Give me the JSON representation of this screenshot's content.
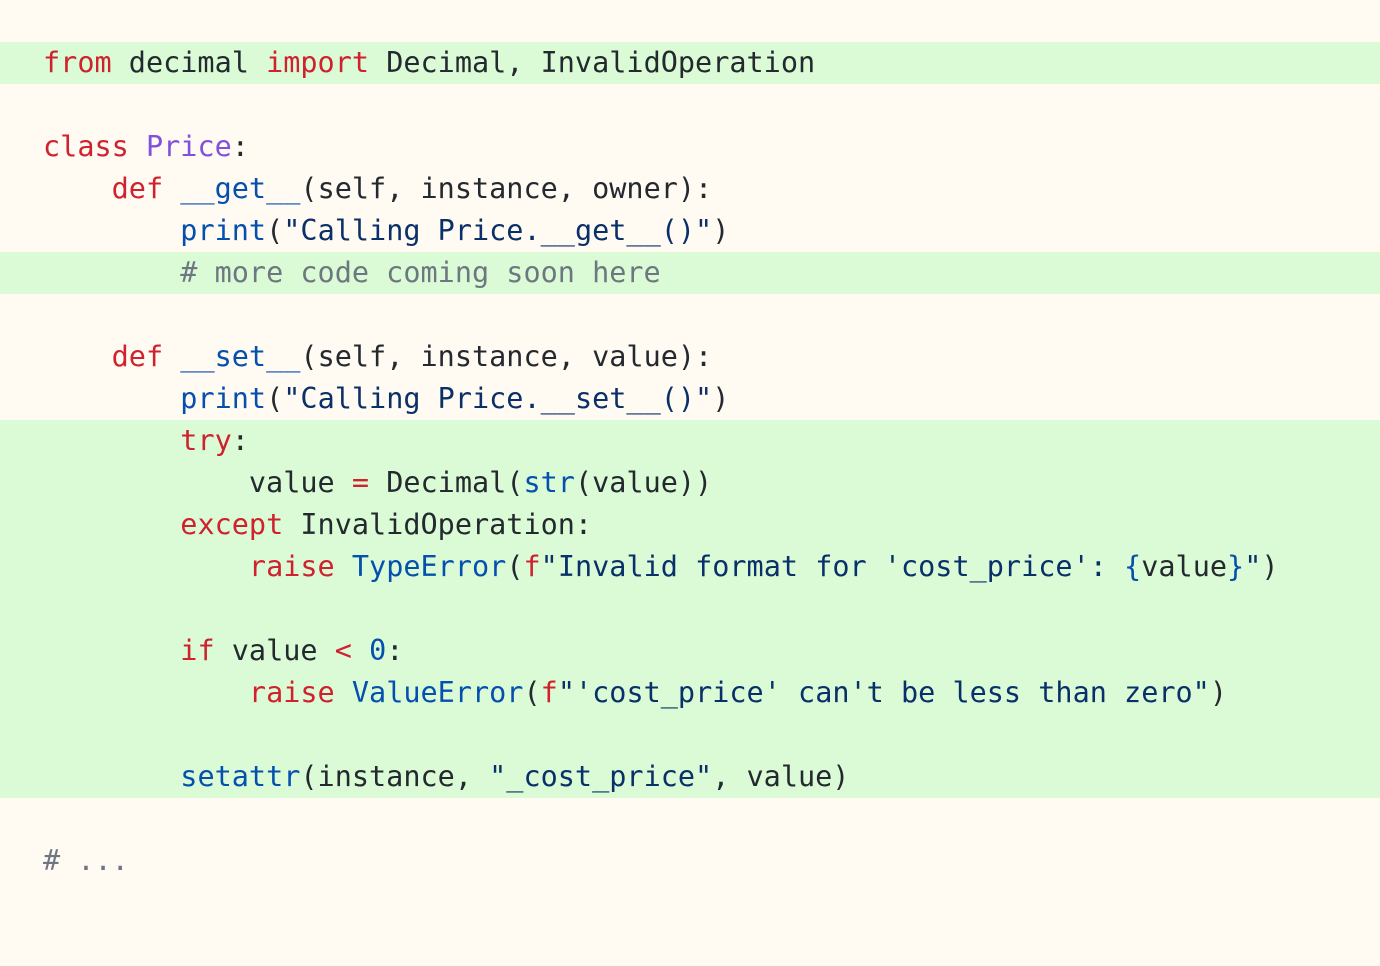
{
  "editor": {
    "background": "#fffaf2",
    "highlight_color": "#dafbd6",
    "lines": [
      {
        "hl": true,
        "tokens": [
          {
            "t": "from",
            "c": "keyword"
          },
          {
            "t": " decimal ",
            "c": "plain"
          },
          {
            "t": "import",
            "c": "keyword"
          },
          {
            "t": " Decimal, InvalidOperation",
            "c": "plain"
          }
        ]
      },
      {
        "hl": false,
        "tokens": []
      },
      {
        "hl": false,
        "tokens": [
          {
            "t": "class",
            "c": "keyword"
          },
          {
            "t": " ",
            "c": "plain"
          },
          {
            "t": "Price",
            "c": "class"
          },
          {
            "t": ":",
            "c": "plain"
          }
        ]
      },
      {
        "hl": false,
        "tokens": [
          {
            "t": "    ",
            "c": "plain"
          },
          {
            "t": "def",
            "c": "keyword"
          },
          {
            "t": " ",
            "c": "plain"
          },
          {
            "t": "__get__",
            "c": "func"
          },
          {
            "t": "(self, instance, owner):",
            "c": "plain"
          }
        ]
      },
      {
        "hl": false,
        "tokens": [
          {
            "t": "        ",
            "c": "plain"
          },
          {
            "t": "print",
            "c": "builtin"
          },
          {
            "t": "(",
            "c": "plain"
          },
          {
            "t": "\"Calling Price.__get__()\"",
            "c": "string"
          },
          {
            "t": ")",
            "c": "plain"
          }
        ]
      },
      {
        "hl": true,
        "tokens": [
          {
            "t": "        ",
            "c": "plain"
          },
          {
            "t": "# more code coming soon here",
            "c": "comment"
          }
        ]
      },
      {
        "hl": false,
        "tokens": []
      },
      {
        "hl": false,
        "tokens": [
          {
            "t": "    ",
            "c": "plain"
          },
          {
            "t": "def",
            "c": "keyword"
          },
          {
            "t": " ",
            "c": "plain"
          },
          {
            "t": "__set__",
            "c": "func"
          },
          {
            "t": "(self, instance, value):",
            "c": "plain"
          }
        ]
      },
      {
        "hl": false,
        "tokens": [
          {
            "t": "        ",
            "c": "plain"
          },
          {
            "t": "print",
            "c": "builtin"
          },
          {
            "t": "(",
            "c": "plain"
          },
          {
            "t": "\"Calling Price.__set__()\"",
            "c": "string"
          },
          {
            "t": ")",
            "c": "plain"
          }
        ]
      },
      {
        "hl": true,
        "tokens": [
          {
            "t": "        ",
            "c": "plain"
          },
          {
            "t": "try",
            "c": "keyword"
          },
          {
            "t": ":",
            "c": "plain"
          }
        ]
      },
      {
        "hl": true,
        "tokens": [
          {
            "t": "            value ",
            "c": "plain"
          },
          {
            "t": "=",
            "c": "operator"
          },
          {
            "t": " Decimal(",
            "c": "plain"
          },
          {
            "t": "str",
            "c": "builtin"
          },
          {
            "t": "(value))",
            "c": "plain"
          }
        ]
      },
      {
        "hl": true,
        "tokens": [
          {
            "t": "        ",
            "c": "plain"
          },
          {
            "t": "except",
            "c": "keyword"
          },
          {
            "t": " InvalidOperation:",
            "c": "plain"
          }
        ]
      },
      {
        "hl": true,
        "tokens": [
          {
            "t": "            ",
            "c": "plain"
          },
          {
            "t": "raise",
            "c": "keyword"
          },
          {
            "t": " ",
            "c": "plain"
          },
          {
            "t": "TypeError",
            "c": "builtin"
          },
          {
            "t": "(",
            "c": "plain"
          },
          {
            "t": "f",
            "c": "keyword"
          },
          {
            "t": "\"Invalid format for 'cost_price': ",
            "c": "string"
          },
          {
            "t": "{",
            "c": "interp"
          },
          {
            "t": "value",
            "c": "plain"
          },
          {
            "t": "}",
            "c": "interp"
          },
          {
            "t": "\"",
            "c": "string"
          },
          {
            "t": ")",
            "c": "plain"
          }
        ]
      },
      {
        "hl": true,
        "tokens": []
      },
      {
        "hl": true,
        "tokens": [
          {
            "t": "        ",
            "c": "plain"
          },
          {
            "t": "if",
            "c": "keyword"
          },
          {
            "t": " value ",
            "c": "plain"
          },
          {
            "t": "<",
            "c": "operator"
          },
          {
            "t": " ",
            "c": "plain"
          },
          {
            "t": "0",
            "c": "number"
          },
          {
            "t": ":",
            "c": "plain"
          }
        ]
      },
      {
        "hl": true,
        "tokens": [
          {
            "t": "            ",
            "c": "plain"
          },
          {
            "t": "raise",
            "c": "keyword"
          },
          {
            "t": " ",
            "c": "plain"
          },
          {
            "t": "ValueError",
            "c": "builtin"
          },
          {
            "t": "(",
            "c": "plain"
          },
          {
            "t": "f",
            "c": "keyword"
          },
          {
            "t": "\"'cost_price' can't be less than zero\"",
            "c": "string"
          },
          {
            "t": ")",
            "c": "plain"
          }
        ]
      },
      {
        "hl": true,
        "tokens": []
      },
      {
        "hl": true,
        "tokens": [
          {
            "t": "        ",
            "c": "plain"
          },
          {
            "t": "setattr",
            "c": "builtin"
          },
          {
            "t": "(instance, ",
            "c": "plain"
          },
          {
            "t": "\"_cost_price\"",
            "c": "string"
          },
          {
            "t": ", value)",
            "c": "plain"
          }
        ]
      },
      {
        "hl": false,
        "tokens": []
      },
      {
        "hl": false,
        "tokens": [
          {
            "t": "# ...",
            "c": "comment"
          }
        ]
      }
    ]
  }
}
